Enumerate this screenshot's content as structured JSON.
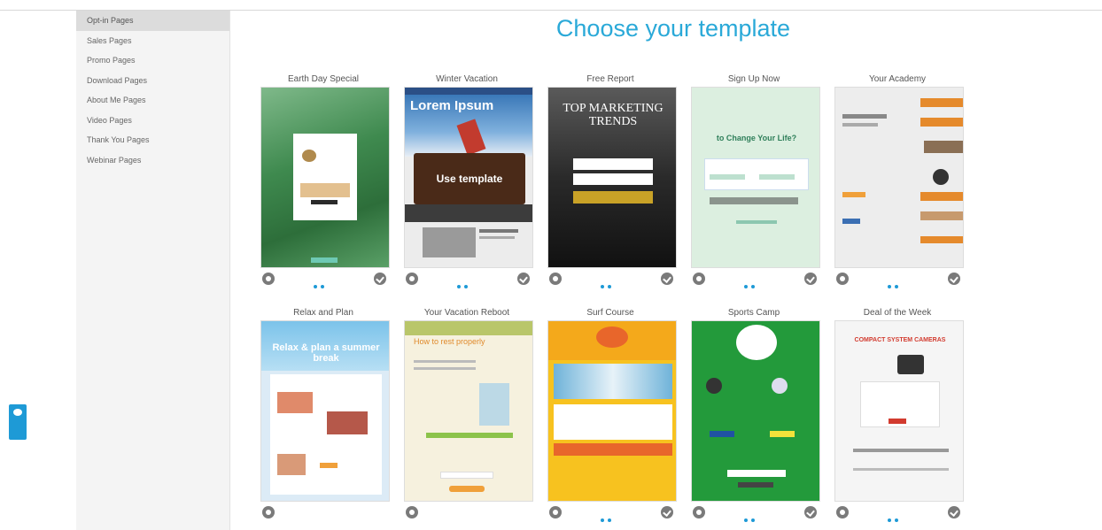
{
  "sidebar": {
    "items": [
      {
        "label": "Opt-in Pages"
      },
      {
        "label": "Sales Pages"
      },
      {
        "label": "Promo Pages"
      },
      {
        "label": "Download Pages"
      },
      {
        "label": "About Me Pages"
      },
      {
        "label": "Video Pages"
      },
      {
        "label": "Thank You Pages"
      },
      {
        "label": "Webinar Pages"
      }
    ],
    "active_index": 0
  },
  "main": {
    "title": "Choose your template",
    "templates": [
      {
        "name": "Earth Day Special"
      },
      {
        "name": "Winter Vacation",
        "thumb_text": "Lorem Ipsum",
        "overlay_label": "Use template"
      },
      {
        "name": "Free Report",
        "thumb_text": "TOP MARKETING TRENDS"
      },
      {
        "name": "Sign Up Now",
        "thumb_text": "to Change Your Life?"
      },
      {
        "name": "Your Academy"
      },
      {
        "name": "Relax and Plan",
        "thumb_text": "Relax & plan a summer break"
      },
      {
        "name": "Your Vacation Reboot",
        "thumb_text": "How to rest properly"
      },
      {
        "name": "Surf Course"
      },
      {
        "name": "Sports Camp"
      },
      {
        "name": "Deal of the Week",
        "thumb_text": "COMPACT SYSTEM CAMERAS"
      }
    ]
  },
  "colors": {
    "accent": "#2aa9d8",
    "chat_tab": "#1e9ad6",
    "control_icon": "#7a7a7a"
  }
}
